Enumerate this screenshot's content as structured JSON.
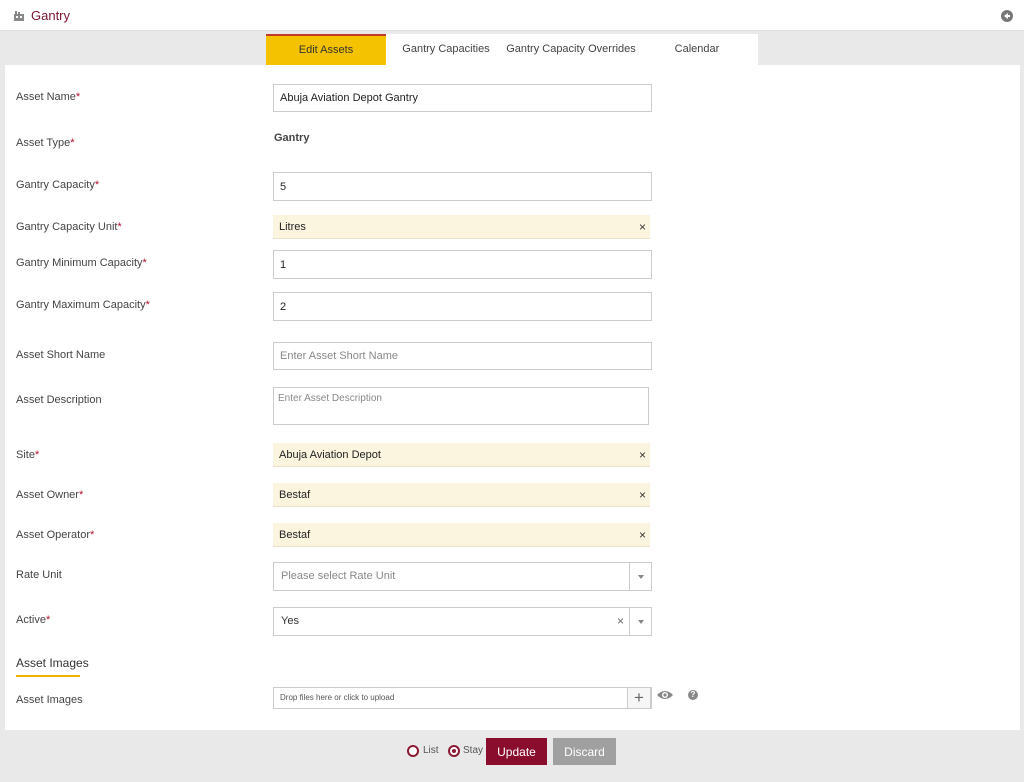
{
  "header": {
    "title": "Gantry",
    "icon": "factory-icon",
    "back_icon": "back-arrow-icon"
  },
  "tabs": [
    {
      "label": "Edit Assets",
      "active": true
    },
    {
      "label": "Gantry Capacities",
      "active": false
    },
    {
      "label": "Gantry Capacity Overrides",
      "active": false
    },
    {
      "label": "Calendar",
      "active": false
    }
  ],
  "form": {
    "asset_name": {
      "label": "Asset Name",
      "value": "Abuja Aviation Depot Gantry"
    },
    "asset_type": {
      "label": "Asset Type",
      "value": "Gantry"
    },
    "gantry_capacity": {
      "label": "Gantry Capacity",
      "value": "5"
    },
    "gantry_capacity_unit": {
      "label": "Gantry Capacity Unit",
      "value": "Litres"
    },
    "gantry_min_capacity": {
      "label": "Gantry Minimum Capacity",
      "value": "1"
    },
    "gantry_max_capacity": {
      "label": "Gantry Maximum Capacity",
      "value": "2"
    },
    "asset_short_name": {
      "label": "Asset Short Name",
      "placeholder": "Enter Asset Short Name"
    },
    "asset_description": {
      "label": "Asset Description",
      "placeholder": "Enter Asset Description"
    },
    "site": {
      "label": "Site",
      "value": "Abuja Aviation Depot"
    },
    "asset_owner": {
      "label": "Asset Owner",
      "value": "Bestaf"
    },
    "asset_operator": {
      "label": "Asset Operator",
      "value": "Bestaf"
    },
    "rate_unit": {
      "label": "Rate Unit",
      "placeholder": "Please select Rate Unit"
    },
    "active": {
      "label": "Active",
      "value": "Yes"
    },
    "required_marker": "*",
    "clear_glyph": "×"
  },
  "images": {
    "section_title": "Asset Images",
    "label": "Asset Images",
    "upload_text": "Drop files here or click to upload",
    "plus": "+",
    "help": "?"
  },
  "footer": {
    "list_label": "List",
    "stay_label": "Stay",
    "selected": "Stay",
    "update_label": "Update",
    "discard_label": "Discard"
  },
  "colors": {
    "accent": "#f5c200",
    "brand": "#8b0d2e",
    "chip_bg": "#fbf4df"
  }
}
